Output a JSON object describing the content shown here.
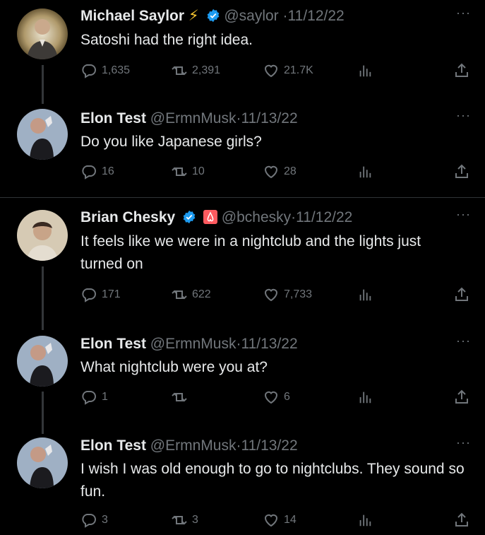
{
  "tweets": [
    {
      "name": "Michael Saylor",
      "emoji": "⚡",
      "handle": "@saylor",
      "sep": "·",
      "date": "11/12/22",
      "text": "Satoshi had the right idea.",
      "replies": "1,635",
      "retweets": "2,391",
      "likes": "21.7K"
    },
    {
      "name": "Elon Test",
      "handle": "@ErmnMusk",
      "sep": "·",
      "date": "11/13/22",
      "text": "Do you like Japanese girls?",
      "replies": "16",
      "retweets": "10",
      "likes": "28"
    },
    {
      "name": "Brian Chesky",
      "handle": "@bchesky",
      "sep": "·",
      "date": "11/12/22",
      "text": "It feels like we were in a nightclub and the lights just turned on",
      "replies": "171",
      "retweets": "622",
      "likes": "7,733"
    },
    {
      "name": "Elon Test",
      "handle": "@ErmnMusk",
      "sep": "·",
      "date": "11/13/22",
      "text": "What nightclub were you at?",
      "replies": "1",
      "retweets": "",
      "likes": "6"
    },
    {
      "name": "Elon Test",
      "handle": "@ErmnMusk",
      "sep": "·",
      "date": "11/13/22",
      "text": "I wish I was old enough to go to nightclubs. They sound so fun.",
      "replies": "3",
      "retweets": "3",
      "likes": "14"
    }
  ],
  "ui": {
    "more": "···",
    "background": "#000000",
    "verified_color": "#1d9bf0",
    "secondary_text": "#71767b"
  },
  "icons": [
    "reply-icon",
    "retweet-icon",
    "like-icon",
    "views-icon",
    "share-icon",
    "verified-icon",
    "airbnb-icon",
    "more-icon"
  ]
}
